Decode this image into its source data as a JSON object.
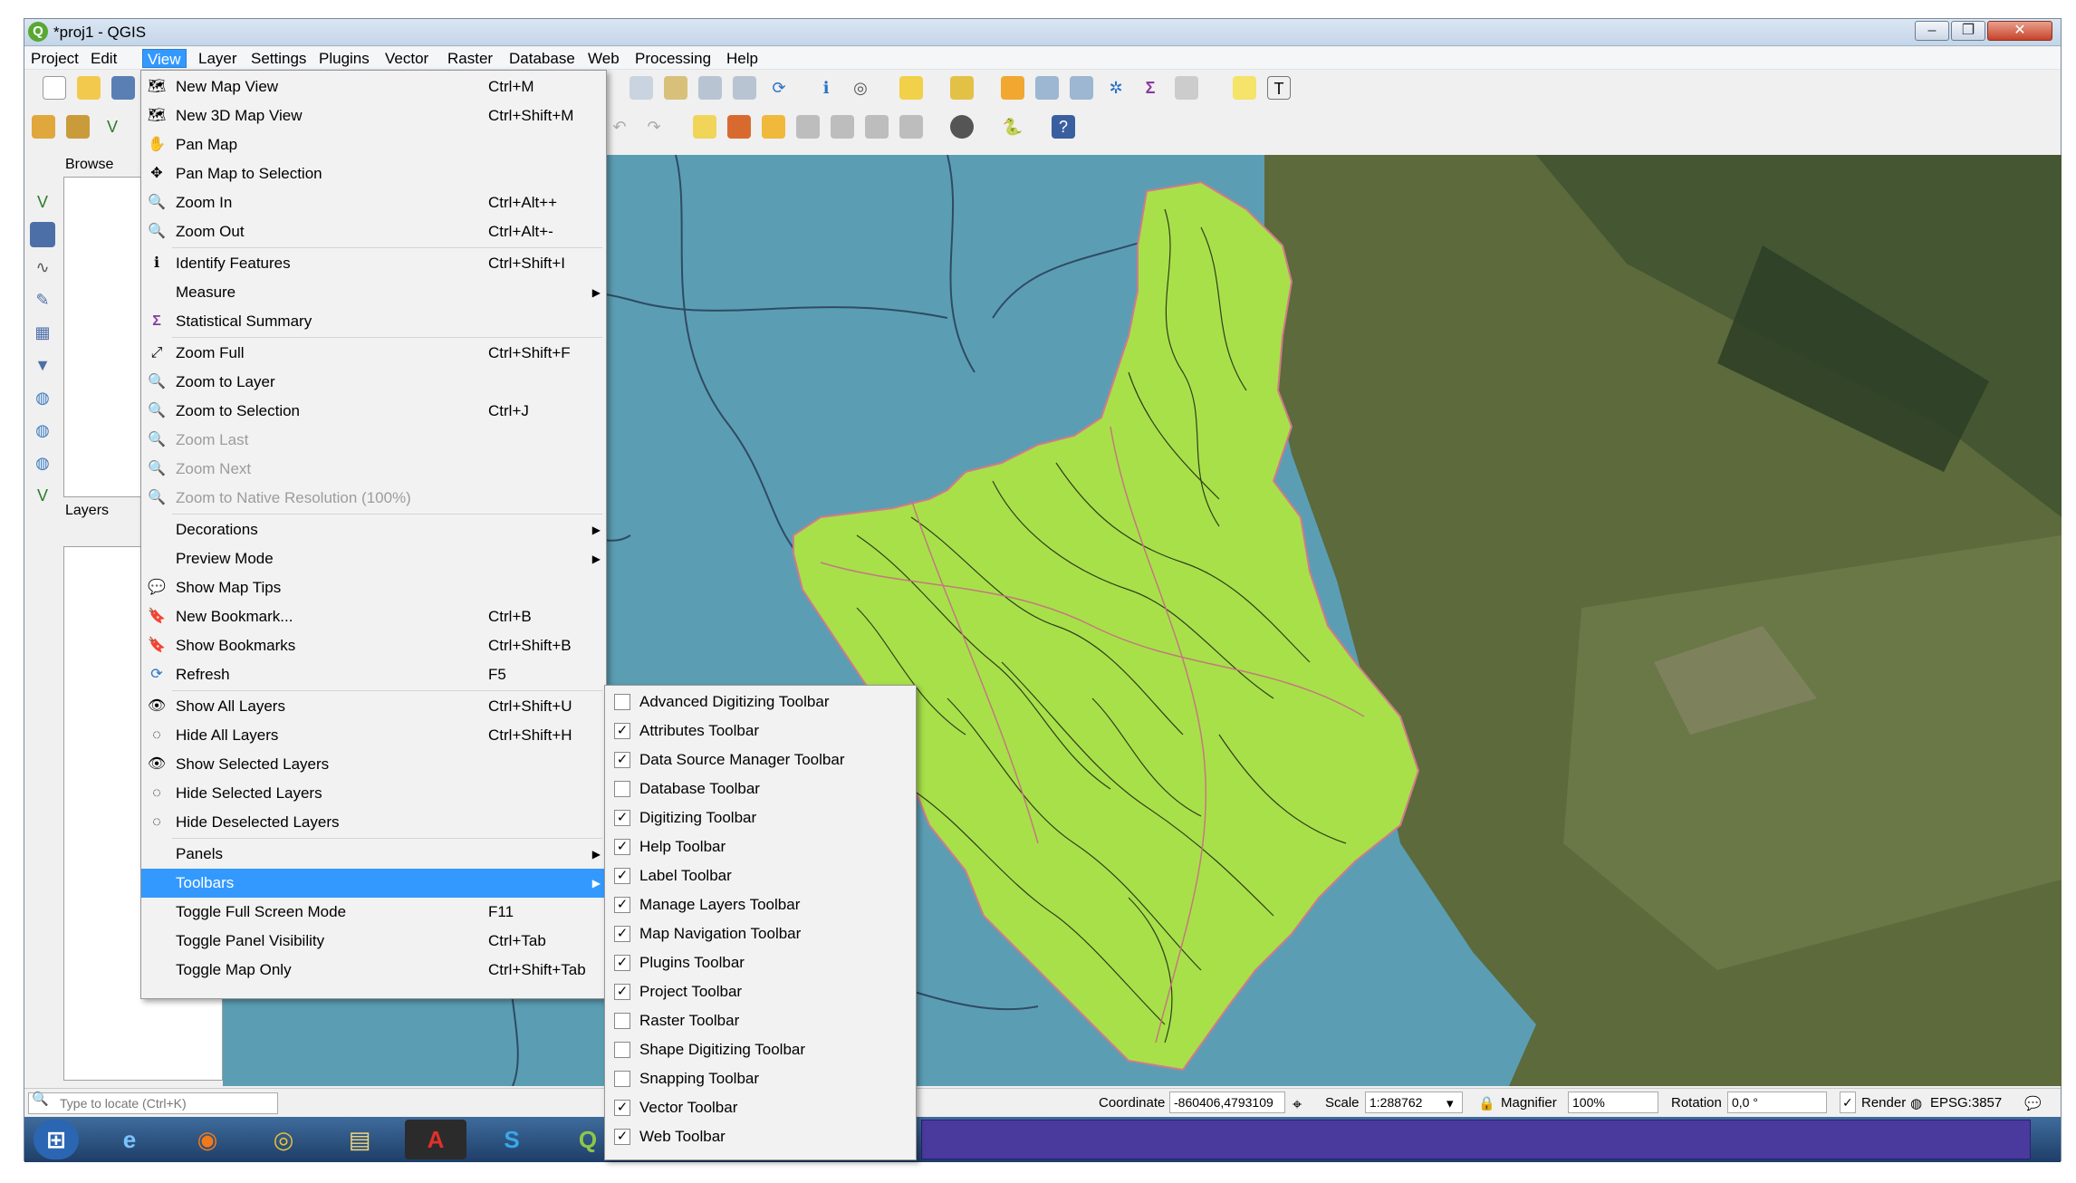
{
  "window": {
    "title": "*proj1 - QGIS",
    "minimize_glyph": "‒",
    "maximize_glyph": "❐",
    "close_glyph": "✕"
  },
  "menubar": [
    "Project",
    "Edit",
    "View",
    "Layer",
    "Settings",
    "Plugins",
    "Vector",
    "Raster",
    "Database",
    "Web",
    "Processing",
    "Help"
  ],
  "panels": {
    "browser_title": "Browse",
    "layers_title": "Layers"
  },
  "view_menu": [
    {
      "label": "New Map View",
      "shortcut": "Ctrl+M",
      "icon": "map-view-icon",
      "glyph": "🗺"
    },
    {
      "label": "New 3D Map View",
      "shortcut": "Ctrl+Shift+M",
      "icon": "3d-map-icon",
      "glyph": "🗺"
    },
    {
      "label": "Pan Map",
      "shortcut": "",
      "icon": "hand-icon",
      "glyph": "✋"
    },
    {
      "label": "Pan Map to Selection",
      "shortcut": "",
      "icon": "pan-selection-icon",
      "glyph": "✥"
    },
    {
      "label": "Zoom In",
      "shortcut": "Ctrl+Alt++",
      "icon": "zoom-in-icon",
      "glyph": "🔍"
    },
    {
      "label": "Zoom Out",
      "shortcut": "Ctrl+Alt+-",
      "icon": "zoom-out-icon",
      "glyph": "🔍"
    },
    {
      "label": "Identify Features",
      "shortcut": "Ctrl+Shift+I",
      "icon": "identify-icon",
      "glyph": "ℹ"
    },
    {
      "label": "Measure",
      "shortcut": "",
      "icon": "",
      "glyph": "",
      "submenu": true
    },
    {
      "label": "Statistical Summary",
      "shortcut": "",
      "icon": "sigma-icon",
      "glyph": "Σ"
    },
    {
      "label": "Zoom Full",
      "shortcut": "Ctrl+Shift+F",
      "icon": "zoom-full-icon",
      "glyph": "⤢"
    },
    {
      "label": "Zoom to Layer",
      "shortcut": "",
      "icon": "zoom-layer-icon",
      "glyph": "🔍"
    },
    {
      "label": "Zoom to Selection",
      "shortcut": "Ctrl+J",
      "icon": "zoom-selection-icon",
      "glyph": "🔍"
    },
    {
      "label": "Zoom Last",
      "shortcut": "",
      "icon": "zoom-last-icon",
      "glyph": "🔍",
      "disabled": true
    },
    {
      "label": "Zoom Next",
      "shortcut": "",
      "icon": "zoom-next-icon",
      "glyph": "🔍",
      "disabled": true
    },
    {
      "label": "Zoom to Native Resolution (100%)",
      "shortcut": "",
      "icon": "zoom-native-icon",
      "glyph": "🔍",
      "disabled": true
    },
    {
      "label": "Decorations",
      "shortcut": "",
      "icon": "",
      "glyph": "",
      "submenu": true
    },
    {
      "label": "Preview Mode",
      "shortcut": "",
      "icon": "",
      "glyph": "",
      "submenu": true
    },
    {
      "label": "Show Map Tips",
      "shortcut": "",
      "icon": "map-tips-icon",
      "glyph": "💬"
    },
    {
      "label": "New Bookmark...",
      "shortcut": "Ctrl+B",
      "icon": "bookmark-new-icon",
      "glyph": "🔖"
    },
    {
      "label": "Show Bookmarks",
      "shortcut": "Ctrl+Shift+B",
      "icon": "bookmarks-icon",
      "glyph": "🔖"
    },
    {
      "label": "Refresh",
      "shortcut": "F5",
      "icon": "refresh-icon",
      "glyph": "⟳"
    },
    {
      "label": "Show All Layers",
      "shortcut": "Ctrl+Shift+U",
      "icon": "show-layers-icon",
      "glyph": "👁"
    },
    {
      "label": "Hide All Layers",
      "shortcut": "Ctrl+Shift+H",
      "icon": "hide-layers-icon",
      "glyph": "◌"
    },
    {
      "label": "Show Selected Layers",
      "shortcut": "",
      "icon": "show-selected-icon",
      "glyph": "👁"
    },
    {
      "label": "Hide Selected Layers",
      "shortcut": "",
      "icon": "hide-selected-icon",
      "glyph": "◌"
    },
    {
      "label": "Hide Deselected Layers",
      "shortcut": "",
      "icon": "hide-deselected-icon",
      "glyph": "◌"
    },
    {
      "label": "Panels",
      "shortcut": "",
      "icon": "",
      "glyph": "",
      "submenu": true
    },
    {
      "label": "Toolbars",
      "shortcut": "",
      "icon": "",
      "glyph": "",
      "submenu": true,
      "highlight": true
    },
    {
      "label": "Toggle Full Screen Mode",
      "shortcut": "F11",
      "icon": "",
      "glyph": ""
    },
    {
      "label": "Toggle Panel Visibility",
      "shortcut": "Ctrl+Tab",
      "icon": "",
      "glyph": ""
    },
    {
      "label": "Toggle Map Only",
      "shortcut": "Ctrl+Shift+Tab",
      "icon": "",
      "glyph": ""
    }
  ],
  "toolbars_submenu": [
    {
      "label": "Advanced Digitizing Toolbar",
      "checked": false
    },
    {
      "label": "Attributes Toolbar",
      "checked": true
    },
    {
      "label": "Data Source Manager Toolbar",
      "checked": true
    },
    {
      "label": "Database Toolbar",
      "checked": false
    },
    {
      "label": "Digitizing Toolbar",
      "checked": true
    },
    {
      "label": "Help Toolbar",
      "checked": true
    },
    {
      "label": "Label Toolbar",
      "checked": true
    },
    {
      "label": "Manage Layers Toolbar",
      "checked": true
    },
    {
      "label": "Map Navigation Toolbar",
      "checked": true
    },
    {
      "label": "Plugins Toolbar",
      "checked": true
    },
    {
      "label": "Project Toolbar",
      "checked": true
    },
    {
      "label": "Raster Toolbar",
      "checked": false
    },
    {
      "label": "Shape Digitizing Toolbar",
      "checked": false
    },
    {
      "label": "Snapping Toolbar",
      "checked": false
    },
    {
      "label": "Vector Toolbar",
      "checked": true
    },
    {
      "label": "Web Toolbar",
      "checked": true
    }
  ],
  "statusbar": {
    "locate_placeholder": "Type to locate (Ctrl+K)",
    "coordinate_label": "Coordinate",
    "coordinate_value": "-860406,4793109",
    "scale_label": "Scale",
    "scale_value": "1:288762",
    "magnifier_label": "Magnifier",
    "magnifier_value": "100%",
    "rotation_label": "Rotation",
    "rotation_value": "0,0 °",
    "render_label": "Render",
    "crs_label": "EPSG:3857"
  },
  "colors": {
    "menu_highlight": "#3399ff",
    "map_water": "#5b9eb4",
    "polygon_fill": "#a8e04a"
  }
}
